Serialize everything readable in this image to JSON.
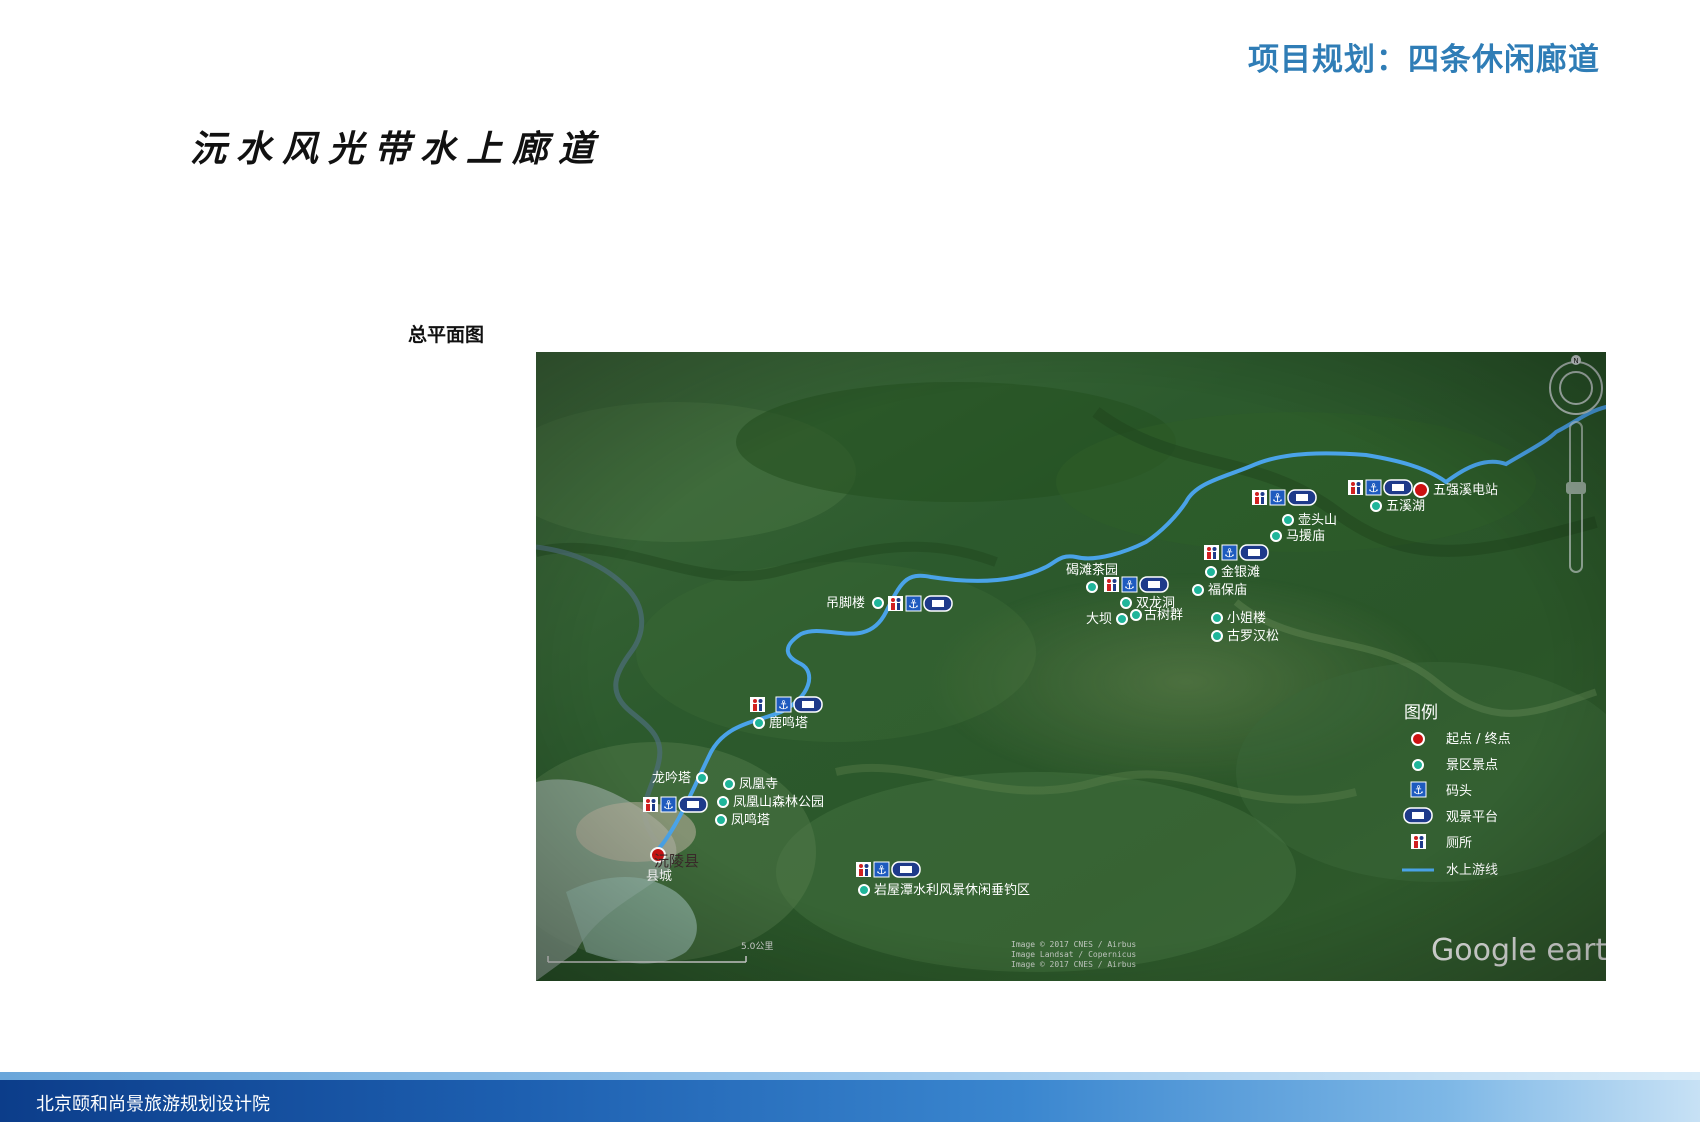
{
  "header": {
    "title": "项目规划：四条休闲廊道"
  },
  "section": {
    "title": "沅水风光带水上廊道"
  },
  "plan": {
    "label": "总平面图"
  },
  "footer": {
    "org": "北京颐和尚景旅游规划设计院"
  },
  "map": {
    "brand": "Google earth",
    "scale_label": "5.0公里",
    "copyright_lines": [
      "Image © 2017 CNES / Airbus",
      "Image Landsat / Copernicus",
      "Image © 2017 CNES / Airbus"
    ],
    "north_label": "N",
    "city_label_1": "沅陵县",
    "city_label_2": "县城",
    "legend": {
      "title": "图例",
      "items": [
        {
          "icon": "start-end-point",
          "label": "起点 / 终点",
          "color": "#cc1111"
        },
        {
          "icon": "scenic-spot",
          "label": "景区景点",
          "color": "#1fb59a"
        },
        {
          "icon": "dock",
          "label": "码头"
        },
        {
          "icon": "viewing-platform",
          "label": "观景平台"
        },
        {
          "icon": "toilet",
          "label": "厕所"
        },
        {
          "icon": "water-route",
          "label": "水上游线",
          "color": "#4aa3e8"
        }
      ]
    },
    "places": {
      "wuqiangxi": "五强溪电站",
      "wuxihu": "五溪湖",
      "hutoushan": "壶头山",
      "mayuanmiao": "马援庙",
      "jinyintan": "金银滩",
      "fubaomiao": "福保庙",
      "xiaojielou": "小姐楼",
      "guluohansong": "古罗汉松",
      "getanchayuan": "碣滩茶园",
      "shuanglongdong": "双龙洞",
      "gushuqun": "古树群",
      "daba": "大坝",
      "diaojiaolou": "吊脚楼",
      "lumingta": "鹿鸣塔",
      "longyinta": "龙吟塔",
      "fenghuangsi": "凤凰寺",
      "fenghuangshan": "凤凰山森林公园",
      "fengmingta": "凤鸣塔",
      "yanwutan": "岩屋潭水利风景休闲垂钓区"
    }
  }
}
